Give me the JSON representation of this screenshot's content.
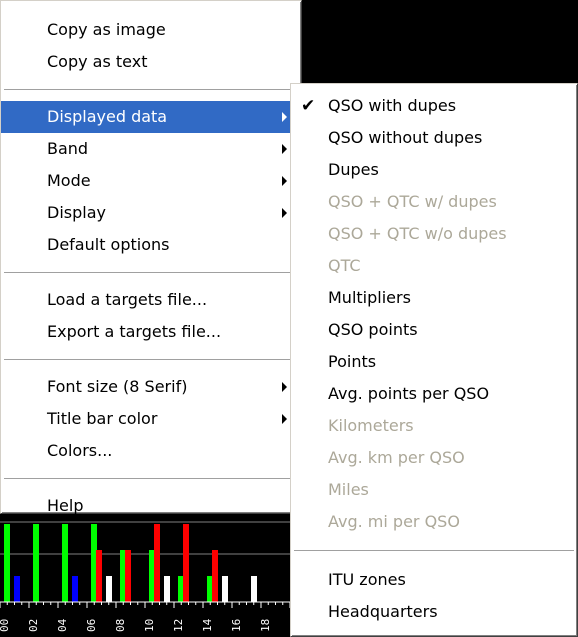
{
  "main_menu": {
    "group1": [
      "Copy as image",
      "Copy as text"
    ],
    "group2": [
      {
        "label": "Displayed data",
        "submenu": true,
        "highlighted": true
      },
      {
        "label": "Band",
        "submenu": true
      },
      {
        "label": "Mode",
        "submenu": true
      },
      {
        "label": "Display",
        "submenu": true
      },
      {
        "label": "Default options",
        "submenu": false
      }
    ],
    "group3": [
      "Load a targets file...",
      "Export a targets file..."
    ],
    "group4": [
      {
        "label": "Font size (8 Serif)",
        "submenu": true
      },
      {
        "label": "Title bar color",
        "submenu": true
      },
      {
        "label": "Colors...",
        "submenu": false
      }
    ],
    "group5": [
      "Help"
    ]
  },
  "sub_menu": {
    "items": [
      {
        "label": "QSO with dupes",
        "checked": true,
        "disabled": false
      },
      {
        "label": "QSO without dupes",
        "disabled": false
      },
      {
        "label": "Dupes",
        "disabled": false
      },
      {
        "label": "QSO + QTC w/ dupes",
        "disabled": true
      },
      {
        "label": "QSO + QTC w/o dupes",
        "disabled": true
      },
      {
        "label": "QTC",
        "disabled": true
      },
      {
        "label": "Multipliers",
        "disabled": false
      },
      {
        "label": "QSO points",
        "disabled": false
      },
      {
        "label": "Points",
        "disabled": false
      },
      {
        "label": "Avg. points per QSO",
        "disabled": false
      },
      {
        "label": "Kilometers",
        "disabled": true
      },
      {
        "label": "Avg. km per QSO",
        "disabled": true
      },
      {
        "label": "Miles",
        "disabled": true
      },
      {
        "label": "Avg. mi per QSO",
        "disabled": true
      }
    ],
    "items2": [
      {
        "label": "ITU zones",
        "disabled": false
      },
      {
        "label": "Headquarters",
        "disabled": false
      }
    ]
  },
  "chart_data": {
    "type": "bar",
    "x_ticks": [
      "00",
      "02",
      "04",
      "06",
      "08",
      "10",
      "12",
      "14",
      "16",
      "18"
    ],
    "series": [
      {
        "values": [
          3,
          3,
          3,
          3,
          2,
          2,
          1,
          1,
          0,
          0
        ]
      },
      {
        "values": [
          0,
          0,
          0,
          2,
          2,
          3,
          3,
          2,
          0,
          0
        ]
      },
      {
        "values": [
          1,
          0,
          1,
          0,
          0,
          0,
          0,
          0,
          0,
          0
        ]
      },
      {
        "values": [
          0,
          0,
          0,
          1,
          0,
          1,
          0,
          1,
          1,
          0
        ]
      }
    ],
    "colors": {
      "green": "#00ff00",
      "red": "#ff0000",
      "blue": "#0000ff",
      "white": "#ffffff"
    }
  }
}
